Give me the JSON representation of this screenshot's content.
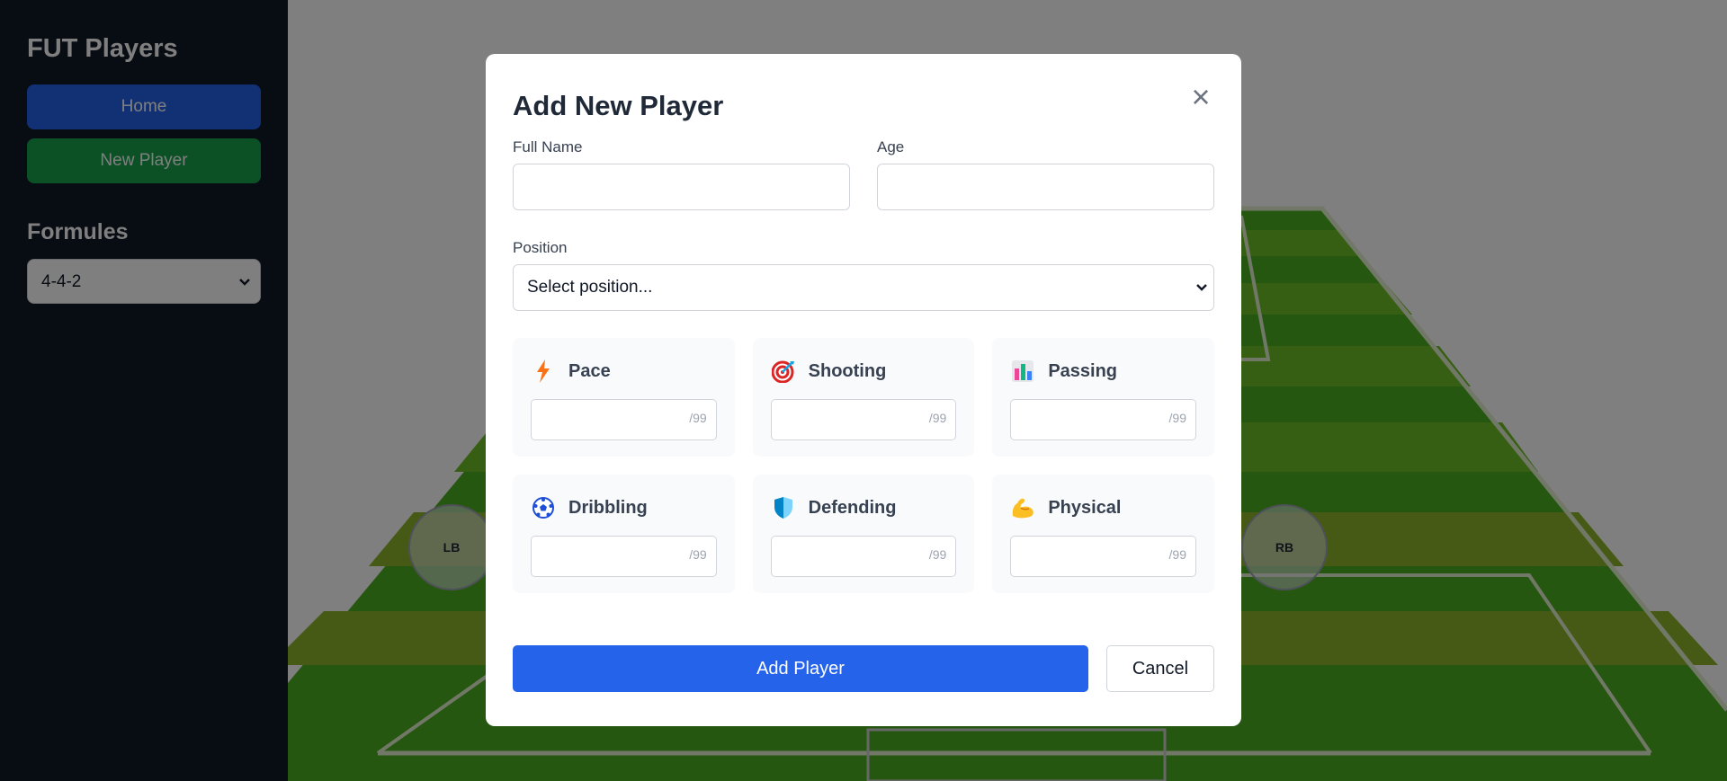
{
  "sidebar": {
    "title": "FUT Players",
    "home_label": "Home",
    "new_player_label": "New Player",
    "formules_title": "Formules",
    "formule_selected": "4-4-2"
  },
  "pitch": {
    "tokens": [
      {
        "label": "LB"
      },
      {
        "label": "RB"
      }
    ]
  },
  "modal": {
    "title": "Add New Player",
    "close_icon": "×",
    "full_name_label": "Full Name",
    "full_name_value": "",
    "age_label": "Age",
    "age_value": "",
    "position_label": "Position",
    "position_selected": "Select position...",
    "stats": [
      {
        "name": "Pace",
        "icon": "lightning-icon",
        "suffix": "/99",
        "value": ""
      },
      {
        "name": "Shooting",
        "icon": "target-icon",
        "suffix": "/99",
        "value": ""
      },
      {
        "name": "Passing",
        "icon": "bar-chart-icon",
        "suffix": "/99",
        "value": ""
      },
      {
        "name": "Dribbling",
        "icon": "soccer-ball-icon",
        "suffix": "/99",
        "value": ""
      },
      {
        "name": "Defending",
        "icon": "shield-icon",
        "suffix": "/99",
        "value": ""
      },
      {
        "name": "Physical",
        "icon": "flexed-bicep-icon",
        "suffix": "/99",
        "value": ""
      }
    ],
    "add_button_label": "Add Player",
    "cancel_button_label": "Cancel"
  },
  "colors": {
    "primary": "#2563eb",
    "success": "#16a34a",
    "sidebar_bg": "#111827",
    "pitch_green": "#4caf20"
  }
}
